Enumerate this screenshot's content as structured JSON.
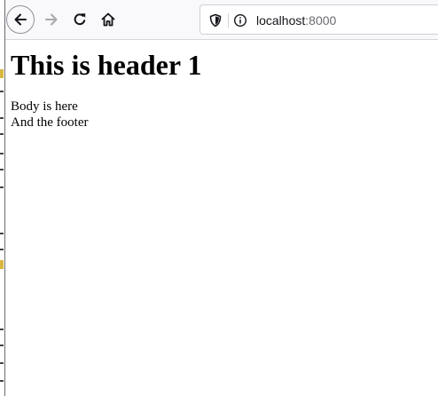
{
  "browser": {
    "url_host": "localhost",
    "url_port": ":8000",
    "buttons": {
      "back": "back-arrow-icon",
      "forward": "forward-arrow-icon",
      "reload": "reload-icon",
      "home": "home-icon"
    },
    "url_icons": [
      "shield-icon",
      "info-icon"
    ]
  },
  "page": {
    "heading": "This is header 1",
    "body_text": "Body is here",
    "footer_text": "And the footer"
  }
}
